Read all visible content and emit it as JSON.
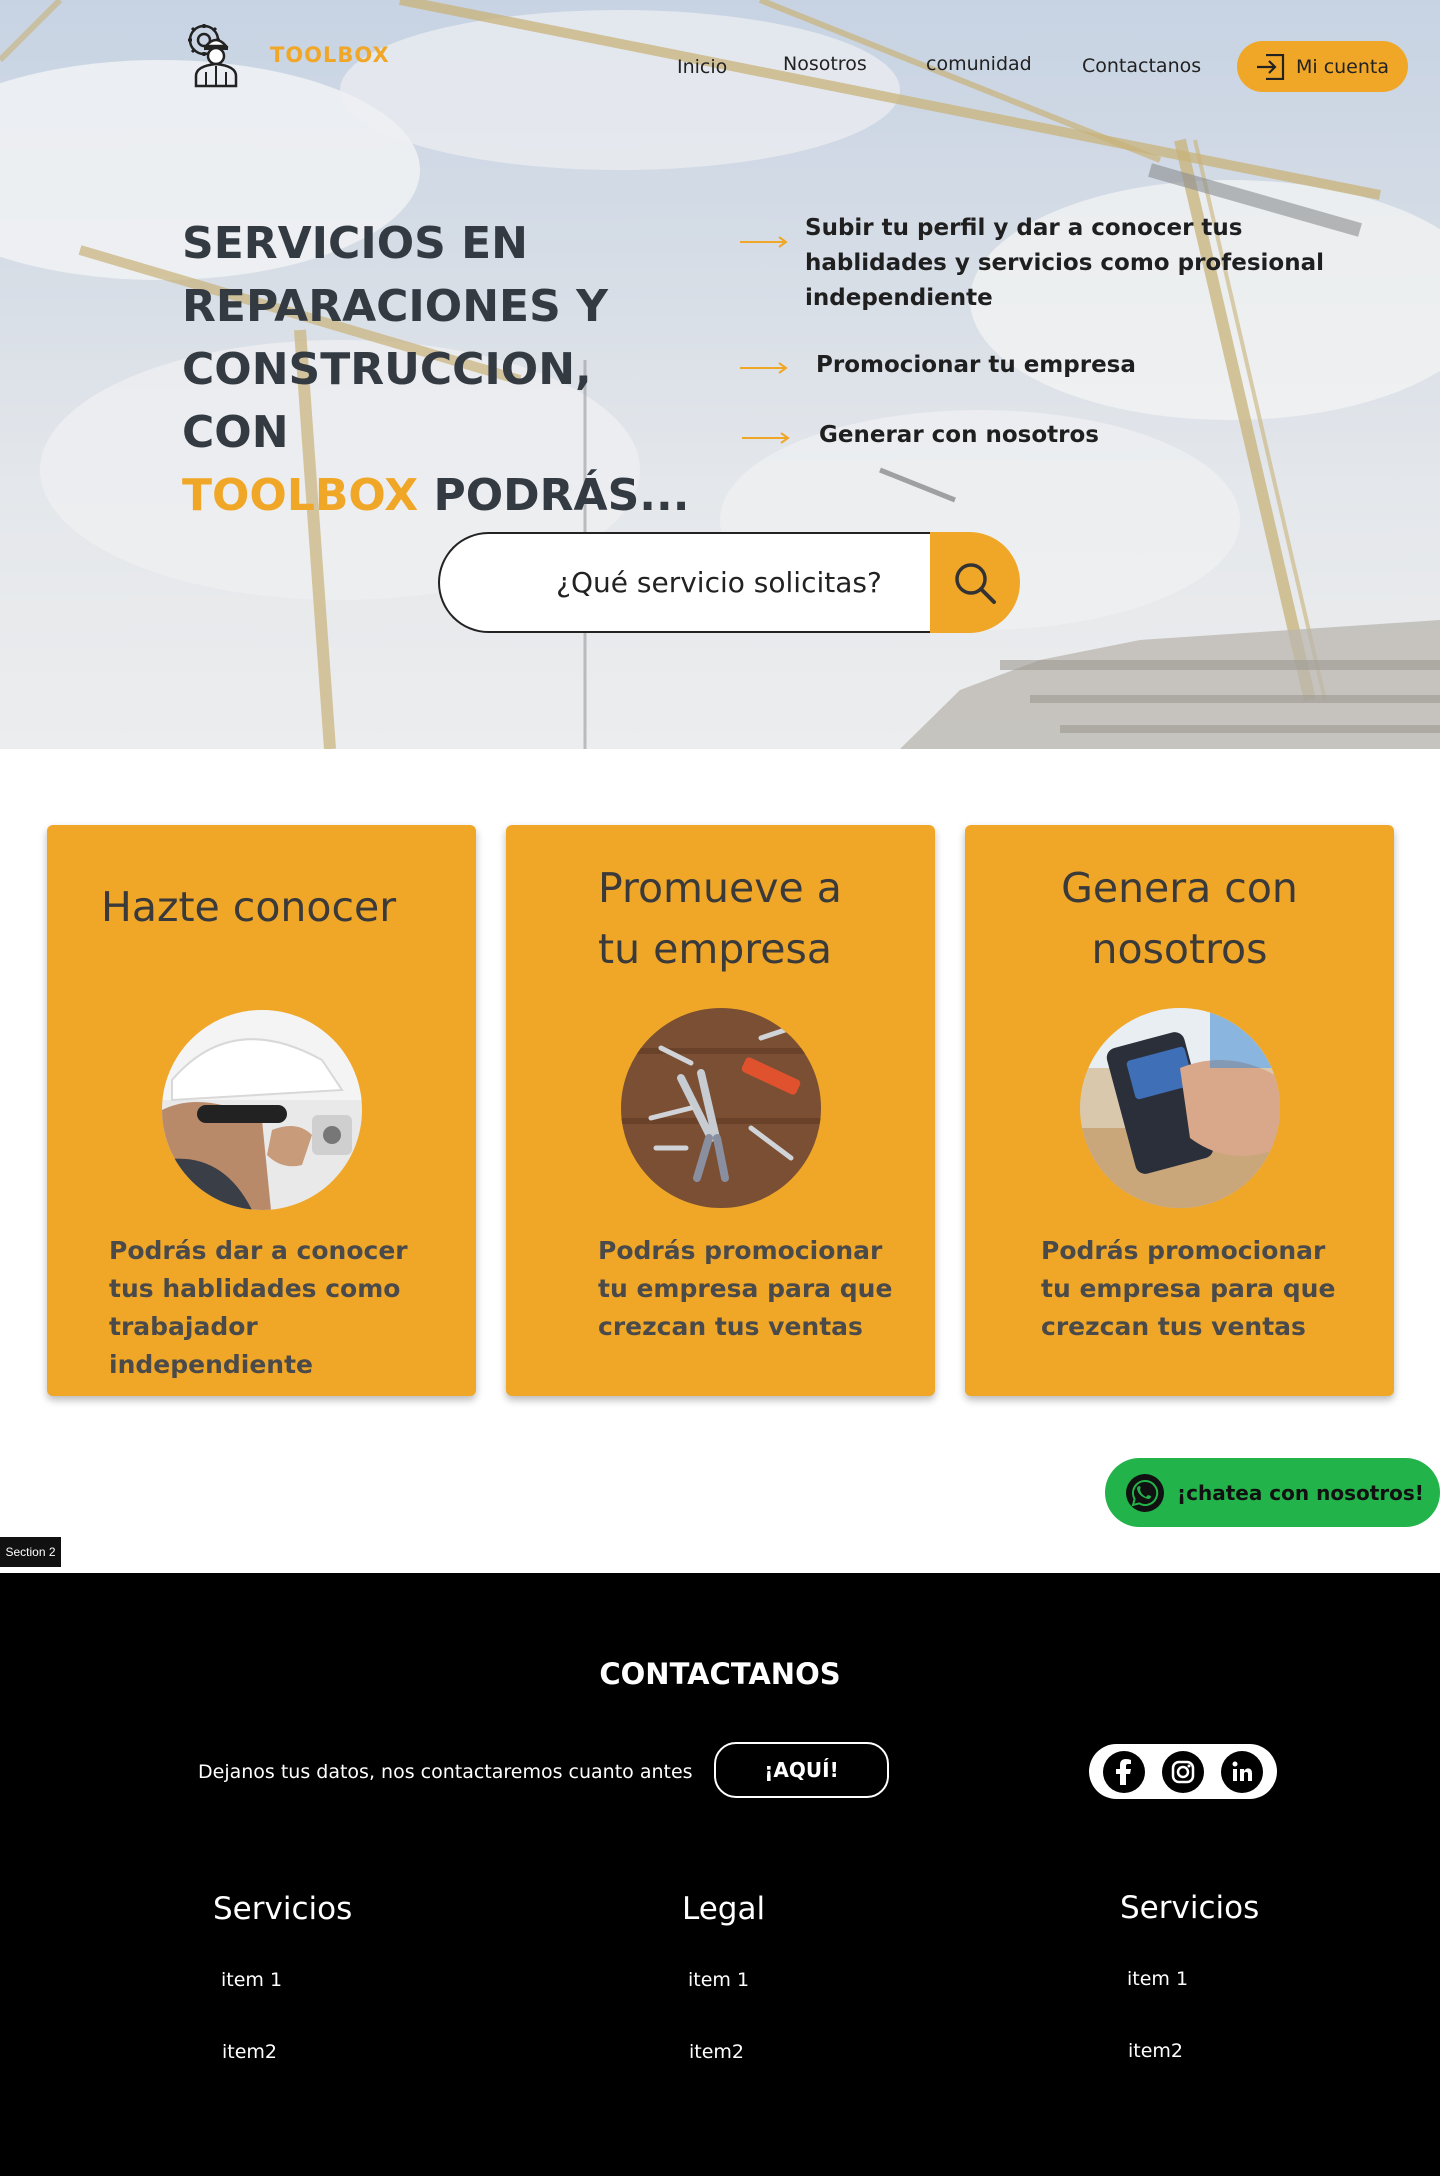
{
  "header": {
    "brand": "TOOLBOX",
    "nav": [
      "Inicio",
      "Nosotros",
      "comunidad",
      "Contactanos"
    ],
    "account_label": "Mi cuenta"
  },
  "hero": {
    "title_line1": "SERVICIOS EN",
    "title_line2": "REPARACIONES Y",
    "title_line3": "CONSTRUCCION, CON",
    "title_accent": "TOOLBOX",
    "title_end": " PODRÁS...",
    "features": [
      "Subir tu perfil y dar a conocer tus hablidades y servicios como profesional independiente",
      "Promocionar tu empresa",
      "Generar con nosotros"
    ]
  },
  "search": {
    "placeholder": "¿Qué servicio solicitas?"
  },
  "cards": [
    {
      "title": "Hazte conocer",
      "desc": "Podrás dar a conocer tus hablidades como trabajador independiente",
      "image": "worker-with-hard-hat"
    },
    {
      "title": "Promueve a tu empresa",
      "desc": "Podrás promocionar tu empresa para que crezcan tus ventas",
      "image": "tools-on-wood"
    },
    {
      "title": "Genera con nosotros",
      "desc": "Podrás promocionar tu empresa para que crezcan tus ventas",
      "image": "card-payment-terminal"
    }
  ],
  "whatsapp": {
    "label": "¡chatea con nosotros!",
    "icon": "whatsapp-icon"
  },
  "section_tag": "Section 2",
  "footer": {
    "title": "CONTACTANOS",
    "message": "Dejanos tus datos, nos contactaremos cuanto antes",
    "button": "¡AQUÍ!",
    "social": [
      "facebook-icon",
      "instagram-icon",
      "linkedin-icon"
    ],
    "columns": [
      {
        "title": "Servicios",
        "items": [
          "item 1",
          "item2"
        ]
      },
      {
        "title": "Legal",
        "items": [
          "item 1",
          "item2"
        ]
      },
      {
        "title": "Servicios",
        "items": [
          "item 1",
          "item2"
        ]
      }
    ]
  },
  "colors": {
    "accent": "#f0a728",
    "whatsapp": "#22b34a",
    "footer_bg": "#000000"
  }
}
